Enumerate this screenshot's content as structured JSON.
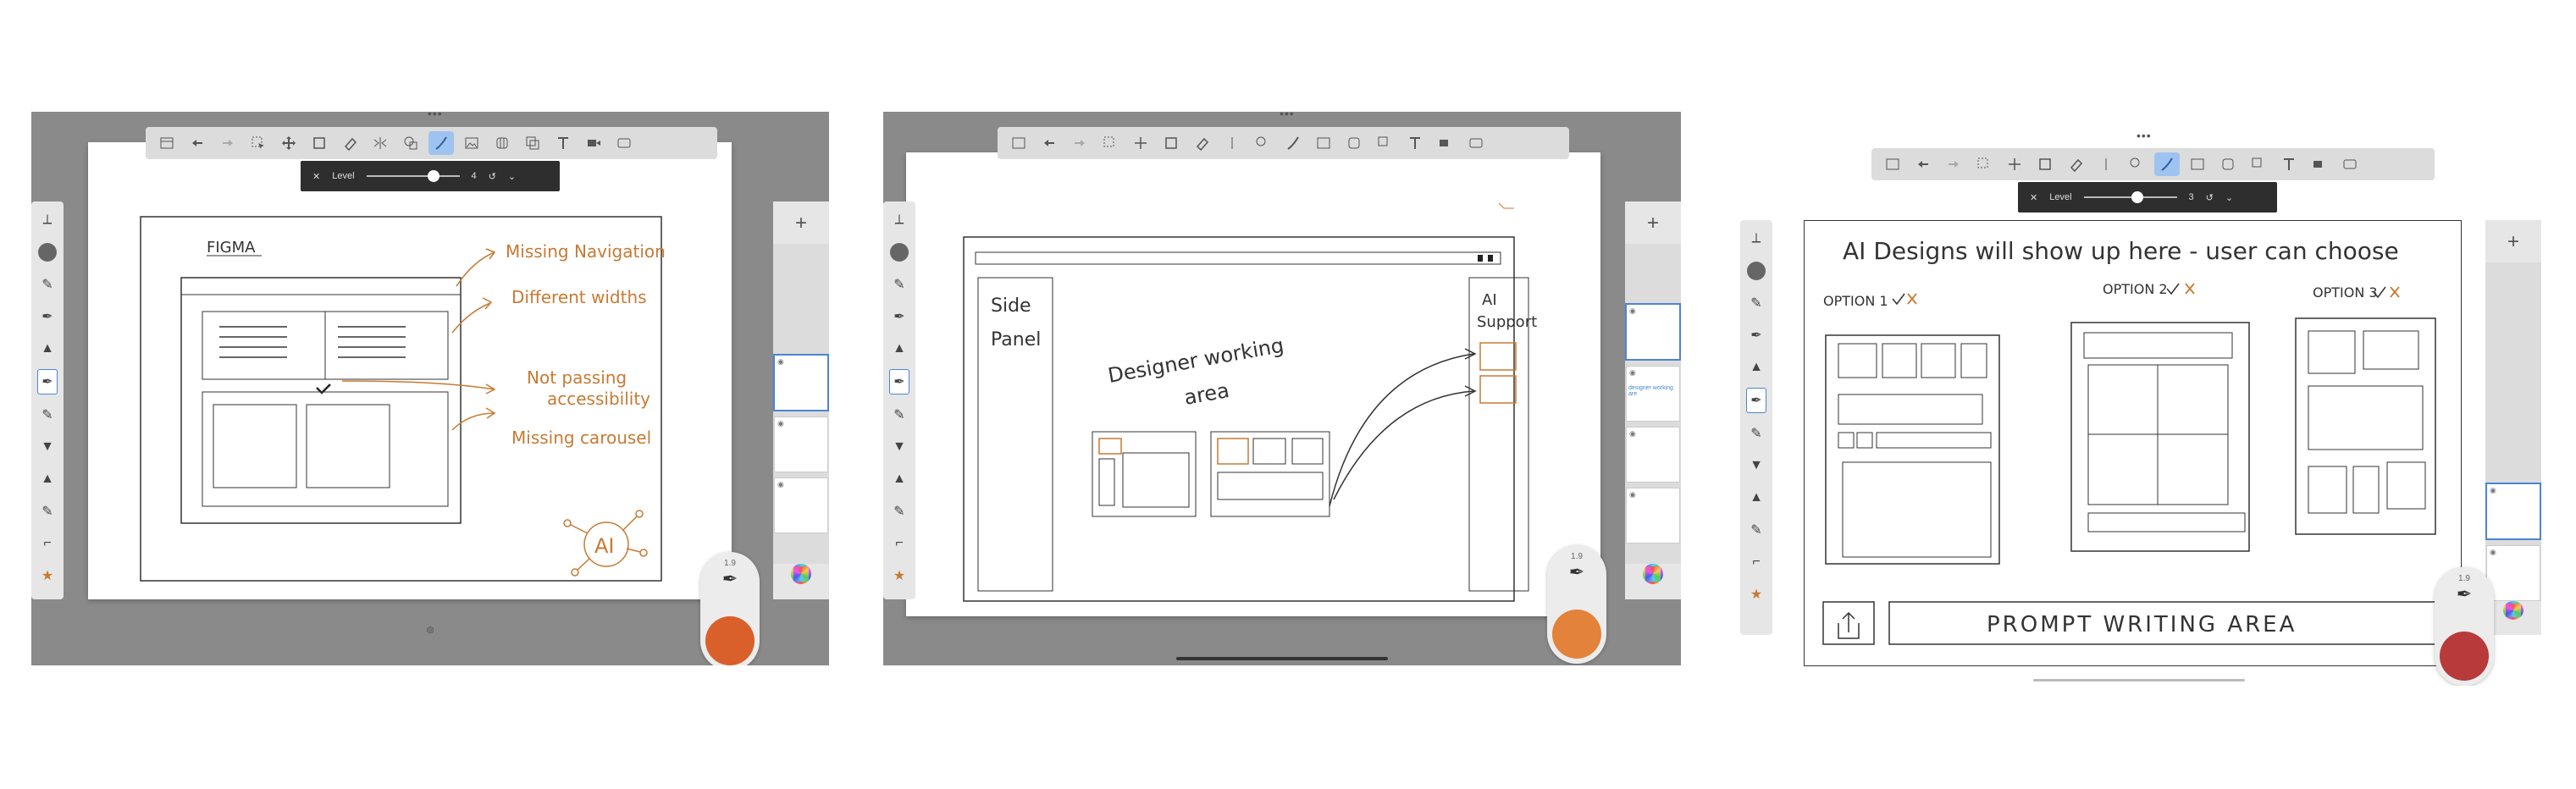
{
  "panels": [
    {
      "id": "panel-1",
      "title_text": "FIGMA",
      "annotations": [
        "Missing Navigation",
        "Different widths",
        "Not passing",
        "accessibility",
        "Missing carousel"
      ],
      "ai_badge": "AI",
      "level": {
        "label": "Level",
        "value": "4"
      },
      "brush_size": "1.9",
      "swatch_color": "#d9602a"
    },
    {
      "id": "panel-2",
      "side_panel_label": [
        "Side",
        "Panel"
      ],
      "designer_label": [
        "Designer working",
        "area"
      ],
      "ai_support_label": [
        "AI",
        "Support"
      ],
      "brush_size": "1.9",
      "swatch_color": "#e3823a",
      "thumb_caption": "designer working are"
    },
    {
      "id": "panel-3",
      "headline": "AI Designs will show up here - user can choose",
      "options": [
        "OPTION 1",
        "OPTION 2",
        "OPTION 3"
      ],
      "prompt_label": "PROMPT WRITING AREA",
      "level": {
        "label": "Level",
        "value": "3"
      },
      "brush_size": "1.9",
      "swatch_color": "#b83a3a"
    }
  ],
  "icons": {
    "toolbar": [
      "gallery-icon",
      "undo-icon",
      "redo-icon",
      "select-icon",
      "move-icon",
      "layer-icon",
      "eraser-icon",
      "symmetry-icon",
      "shape-icon",
      "brush-icon",
      "image-icon",
      "table-icon",
      "copy-icon",
      "text-icon",
      "video-icon",
      "screen-icon"
    ]
  },
  "accent": "#c77a33"
}
